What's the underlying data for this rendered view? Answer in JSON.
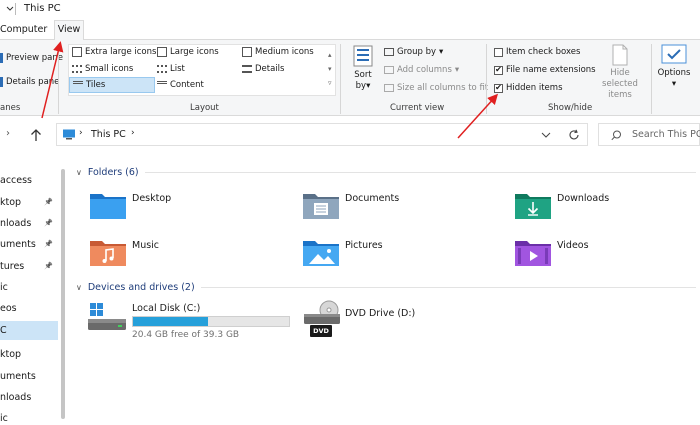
{
  "window": {
    "title": "This PC"
  },
  "tabs": [
    {
      "label": "Computer",
      "active": false
    },
    {
      "label": "View",
      "active": true
    }
  ],
  "ribbon": {
    "panes": {
      "preview_label": "Preview pane",
      "details_label": "Details pane",
      "group_label": "anes"
    },
    "layout": {
      "options": [
        "Extra large icons",
        "Large icons",
        "Medium icons",
        "Small icons",
        "List",
        "Details",
        "Tiles",
        "Content"
      ],
      "selected": "Tiles",
      "group_label": "Layout"
    },
    "current_view": {
      "sort_label": "Sort",
      "sort_by": "by",
      "group_by": "Group by",
      "add_columns": "Add columns",
      "size_columns": "Size all columns to fit",
      "group_label": "Current view"
    },
    "show_hide": {
      "item_checkboxes": {
        "label": "Item check boxes",
        "checked": false
      },
      "file_name_extensions": {
        "label": "File name extensions",
        "checked": true
      },
      "hidden_items": {
        "label": "Hidden items",
        "checked": true
      },
      "hide_selected": "Hide selected items",
      "group_label": "Show/hide"
    },
    "options_label": "Options"
  },
  "address": {
    "path": "This PC",
    "search_placeholder": "Search This PC"
  },
  "nav": {
    "items": [
      "access",
      "ktop",
      "nloads",
      "uments",
      "tures",
      "ic",
      "eos",
      "C",
      "ktop",
      "uments",
      "nloads",
      "ic"
    ],
    "pinned": [
      false,
      true,
      true,
      true,
      true,
      false,
      false,
      false,
      false,
      false,
      false,
      false
    ],
    "selected_index": 7
  },
  "folders": {
    "header": "Folders (6)",
    "items": [
      {
        "name": "Desktop",
        "icon": "desktop-folder-icon"
      },
      {
        "name": "Documents",
        "icon": "documents-folder-icon"
      },
      {
        "name": "Downloads",
        "icon": "downloads-folder-icon"
      },
      {
        "name": "Music",
        "icon": "music-folder-icon"
      },
      {
        "name": "Pictures",
        "icon": "pictures-folder-icon"
      },
      {
        "name": "Videos",
        "icon": "videos-folder-icon"
      }
    ]
  },
  "drives": {
    "header": "Devices and drives (2)",
    "items": [
      {
        "name": "Local Disk (C:)",
        "free": "20.4 GB free of 39.3 GB",
        "used_fraction": 0.48
      },
      {
        "name": "DVD Drive (D:)",
        "badge": "DVD"
      }
    ]
  },
  "colors": {
    "accent": "#0078d4",
    "annotation": "#e02020"
  }
}
